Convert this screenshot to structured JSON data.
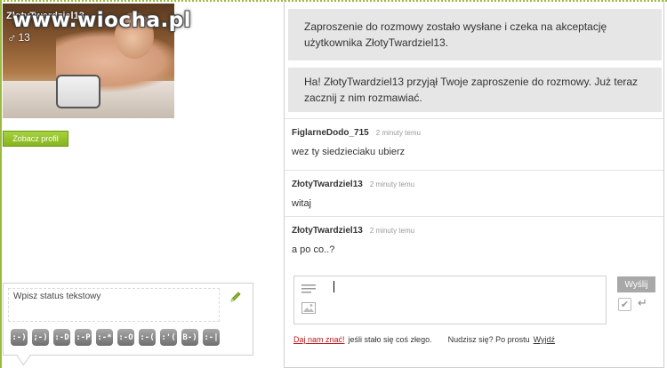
{
  "watermark": "www.wiocha.pl",
  "profile": {
    "username": "ZłotyTwardziel13",
    "age": "13",
    "view_profile_label": "Zobacz profil"
  },
  "status": {
    "placeholder": "Wpisz status tekstowy",
    "emoticons": [
      ":-)",
      ";-)",
      ":-D",
      ":-P",
      ":-*",
      ":-O",
      ":-(",
      ":'(",
      "B-)",
      ":-|"
    ]
  },
  "chat": {
    "system_messages": [
      "Zaproszenie do rozmowy zostało wysłane i czeka na akceptację użytkownika ZłotyTwardziel13.",
      "Ha! ZłotyTwardziel13 przyjął Twoje zaproszenie do rozmowy. Już teraz zacznij z nim rozmawiać."
    ],
    "messages": [
      {
        "author": "FiglarneDodo_715",
        "time": "2 minuty temu",
        "text": "wez ty siedzieciaku ubierz"
      },
      {
        "author": "ZłotyTwardziel13",
        "time": "2 minuty temu",
        "text": "witaj"
      },
      {
        "author": "ZłotyTwardziel13",
        "time": "2 minuty temu",
        "text": "a po co..?"
      }
    ],
    "send_label": "Wyślij",
    "checkbox_mark": "✔"
  },
  "footer": {
    "report_link": "Daj nam znać!",
    "report_text": "jeśli stało się coś złego.",
    "bored_text": "Nudzisz się? Po prostu",
    "leave_link": "Wyjdź"
  },
  "colors": {
    "accent_green": "#9bbb3c",
    "button_green": "#86b51e",
    "system_bg": "#e6e6e6",
    "report_red": "#b8171a"
  }
}
